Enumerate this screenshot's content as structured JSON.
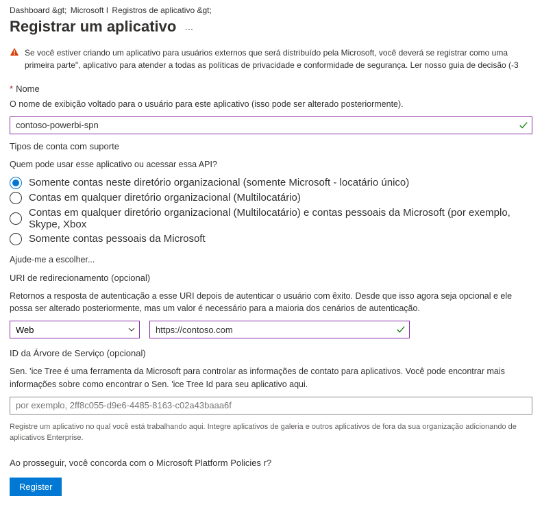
{
  "breadcrumb": {
    "item1": "Dashboard &gt;",
    "item2": "Microsoft I",
    "item3": "Registros de aplicativo &gt;"
  },
  "page": {
    "title": "Registrar um aplicativo",
    "more": "…"
  },
  "info": {
    "text": "Se você estiver criando um aplicativo para usuários externos que será distribuído pela Microsoft, você deverá se registrar como uma primeira parte\", aplicativo para atender a todas as políticas de privacidade e conformidade de segurança. Ler nosso guia de decisão (-3"
  },
  "name": {
    "label": "Nome",
    "help": "O nome de exibição voltado para o usuário para este aplicativo (isso pode ser alterado posteriormente).",
    "value": "contoso-powerbi-spn"
  },
  "accountTypes": {
    "label": "Tipos de conta com suporte",
    "question": "Quem pode usar esse aplicativo ou acessar essa API?",
    "options": {
      "o1": "Somente contas neste diretório organizacional (somente Microsoft - locatário único)",
      "o2": "Contas em qualquer diretório organizacional (Multilocatário)",
      "o3": "Contas em qualquer diretório organizacional (Multilocatário) e contas pessoais da Microsoft (por exemplo, Skype, Xbox",
      "o4": "Somente contas pessoais da Microsoft"
    },
    "helpLink": "Ajude-me a escolher..."
  },
  "redirectUri": {
    "label": "URI de redirecionamento (opcional)",
    "help": "Retornos a resposta de autenticação a esse URI depois de autenticar o usuário com êxito. Desde que isso agora seja opcional e ele possa ser alterado posteriormente, mas um valor é necessário para a maioria dos cenários de autenticação.",
    "platform": "Web",
    "value": "https://contoso.com"
  },
  "serviceTree": {
    "label": "ID da Árvore de Serviço (opcional)",
    "help": "Sen. 'ice Tree é uma ferramenta da Microsoft para controlar as informações de contato para aplicativos. Você pode encontrar mais informações sobre como encontrar o Sen. 'ice Tree Id para seu aplicativo aqui.",
    "placeholder": "por exemplo, 2ff8c055-d9e6-4485-8163-c02a43baaa6f"
  },
  "footerNote": "Registre um aplicativo no qual você está trabalhando aqui. Integre aplicativos de galeria e outros aplicativos de fora da sua organização adicionando de aplicativos Enterprise.",
  "consent": "Ao prosseguir, você concorda com o Microsoft Platform Policies r?",
  "registerBtn": "Register"
}
